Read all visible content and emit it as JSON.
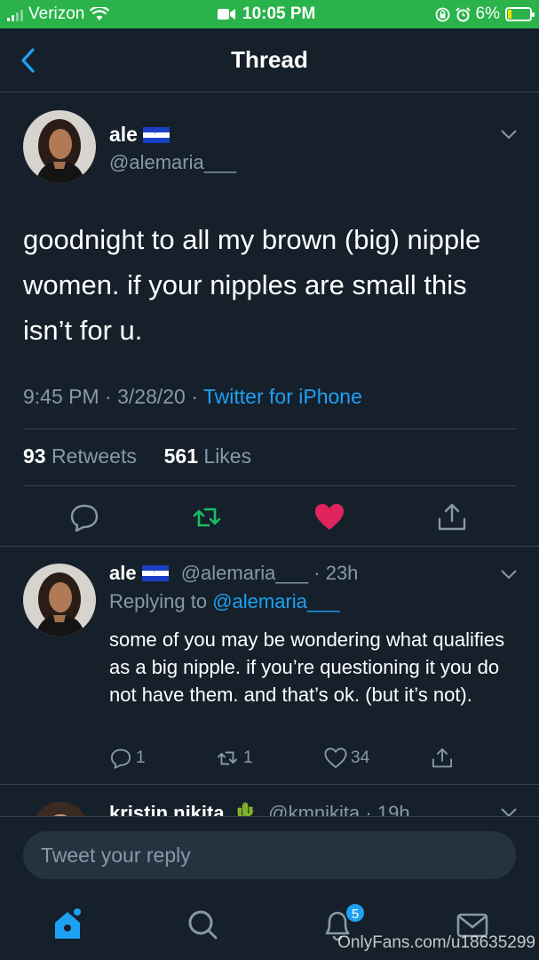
{
  "status_bar": {
    "carrier": "Verizon",
    "time": "10:05 PM",
    "battery": "6%"
  },
  "header": {
    "title": "Thread"
  },
  "main_tweet": {
    "name": "ale",
    "handle": "@alemaria___",
    "text": "goodnight to all my brown (big) nipple women. if your nipples are small this isn’t for u.",
    "time": "9:45 PM",
    "date": "3/28/20",
    "source": "Twitter for iPhone",
    "retweets_count": "93",
    "retweets_label": "Retweets",
    "likes_count": "561",
    "likes_label": "Likes",
    "liked": true
  },
  "reply_tweet": {
    "name": "ale",
    "handle": "@alemaria___",
    "age": "23h",
    "replying_to_label": "Replying to",
    "replying_to_handle": "@alemaria___",
    "text": "some of you may be wondering what qualifies as a big nipple. if you’re questioning it you do not have them. and that’s ok. (but it’s not).",
    "reply_count": "1",
    "retweet_count": "1",
    "like_count": "34"
  },
  "next_tweet": {
    "name": "kristin nikita",
    "handle": "@kmnikita",
    "age": "19h"
  },
  "reply_input": {
    "placeholder": "Tweet your reply"
  },
  "tab_bar": {
    "notifications_badge": "5"
  },
  "watermark": "OnlyFans.com/u18635299",
  "colors": {
    "background": "#15202b",
    "accent": "#1da1f2",
    "like": "#e0245e",
    "retweet": "#17bf63",
    "status_bar": "#29b34a"
  }
}
